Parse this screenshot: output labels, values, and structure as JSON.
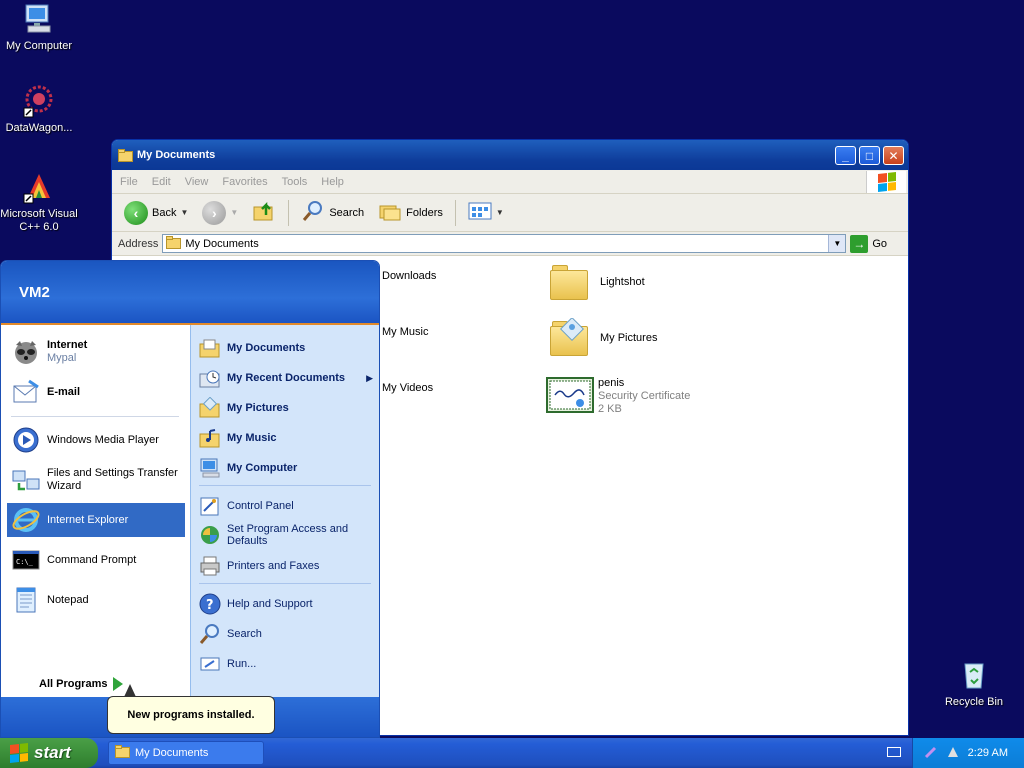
{
  "desktop": {
    "icons": [
      {
        "label": "My Computer"
      },
      {
        "label": "DataWagon..."
      },
      {
        "label": "Microsoft Visual C++ 6.0"
      },
      {
        "label": "Recycle Bin"
      }
    ]
  },
  "window": {
    "title": "My Documents",
    "menu": [
      "File",
      "Edit",
      "View",
      "Favorites",
      "Tools",
      "Help"
    ],
    "toolbar": {
      "back": "Back",
      "search": "Search",
      "folders": "Folders"
    },
    "address": {
      "label": "Address",
      "value": "My Documents",
      "go": "Go"
    },
    "files": [
      {
        "name": "Downloads"
      },
      {
        "name": "Lightshot"
      },
      {
        "name": "My Music"
      },
      {
        "name": "My Pictures"
      },
      {
        "name": "My Videos"
      },
      {
        "name": "penis",
        "type": "Security Certificate",
        "size": "2 KB"
      }
    ]
  },
  "start_menu": {
    "user": "VM2",
    "pinned": [
      {
        "title": "Internet",
        "sub": "Mypal"
      },
      {
        "title": "E-mail"
      }
    ],
    "recent": [
      {
        "label": "Windows Media Player"
      },
      {
        "label": "Files and Settings Transfer Wizard"
      },
      {
        "label": "Internet Explorer"
      },
      {
        "label": "Command Prompt"
      },
      {
        "label": "Notepad"
      }
    ],
    "all_programs": "All Programs",
    "right": [
      {
        "label": "My Documents"
      },
      {
        "label": "My Recent Documents"
      },
      {
        "label": "My Pictures"
      },
      {
        "label": "My Music"
      },
      {
        "label": "My Computer"
      },
      {
        "label": "Control Panel"
      },
      {
        "label": "Set Program Access and Defaults"
      },
      {
        "label": "Printers and Faxes"
      },
      {
        "label": "Help and Support"
      },
      {
        "label": "Search"
      },
      {
        "label": "Run..."
      }
    ]
  },
  "balloon": {
    "text": "New programs installed."
  },
  "taskbar": {
    "start": "start",
    "task": "My Documents",
    "clock": "2:29 AM"
  },
  "colors": {
    "desktop": "#0a0a5e",
    "title_blue": "#0e3c9a",
    "start_green": "#3c8f3a",
    "highlight": "#316ac5"
  }
}
